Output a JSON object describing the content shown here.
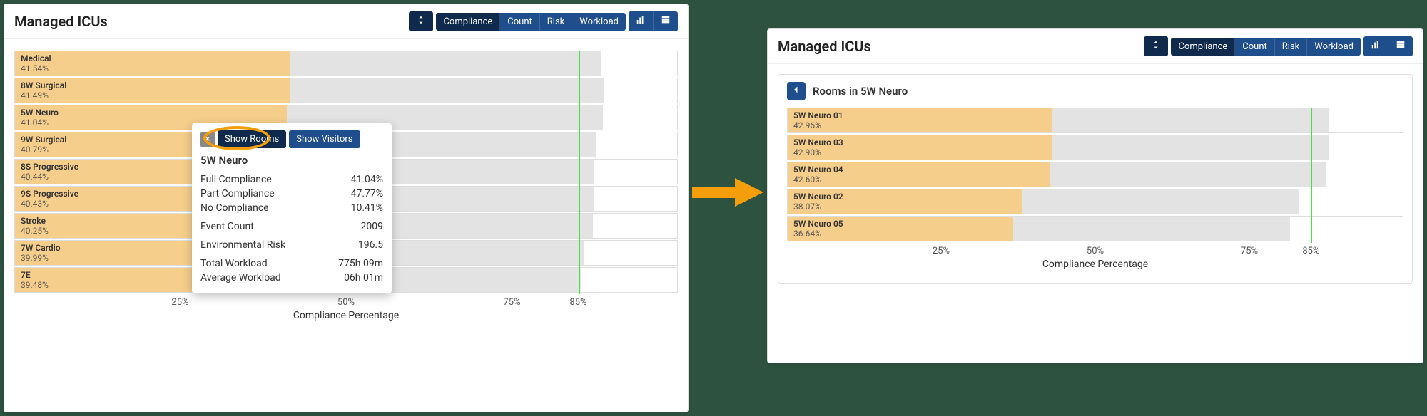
{
  "left": {
    "title": "Managed ICUs",
    "toolbar": {
      "compliance": "Compliance",
      "count": "Count",
      "risk": "Risk",
      "workload": "Workload"
    },
    "axis_label": "Compliance Percentage",
    "ticks": [
      "25%",
      "50%",
      "75%",
      "85%"
    ],
    "threshold": 85,
    "bars": [
      {
        "name": "Medical",
        "pct": "41.54%",
        "full": 41.54,
        "part": 47.0
      },
      {
        "name": "8W Surgical",
        "pct": "41.49%",
        "full": 41.49,
        "part": 47.5
      },
      {
        "name": "5W Neuro",
        "pct": "41.04%",
        "full": 41.04,
        "part": 47.77
      },
      {
        "name": "9W Surgical",
        "pct": "40.79%",
        "full": 40.79,
        "part": 47.0
      },
      {
        "name": "8S Progressive",
        "pct": "40.44%",
        "full": 40.44,
        "part": 47.0
      },
      {
        "name": "9S Progressive",
        "pct": "40.43%",
        "full": 40.43,
        "part": 47.0
      },
      {
        "name": "Stroke",
        "pct": "40.25%",
        "full": 40.25,
        "part": 47.0
      },
      {
        "name": "7W Cardio",
        "pct": "39.99%",
        "full": 39.99,
        "part": 46.0
      },
      {
        "name": "7E",
        "pct": "39.48%",
        "full": 39.48,
        "part": 46.0
      }
    ],
    "popover": {
      "close": "×",
      "show_rooms": "Show Rooms",
      "show_visitors": "Show Visitors",
      "title": "5W Neuro",
      "stats": {
        "full_compliance_label": "Full Compliance",
        "full_compliance_val": "41.04%",
        "part_compliance_label": "Part Compliance",
        "part_compliance_val": "47.77%",
        "no_compliance_label": "No Compliance",
        "no_compliance_val": "10.41%",
        "event_count_label": "Event Count",
        "event_count_val": "2009",
        "env_risk_label": "Environmental Risk",
        "env_risk_val": "196.5",
        "total_workload_label": "Total Workload",
        "total_workload_val": "775h 09m",
        "avg_workload_label": "Average Workload",
        "avg_workload_val": "06h 01m"
      }
    }
  },
  "right": {
    "title": "Managed ICUs",
    "toolbar": {
      "compliance": "Compliance",
      "count": "Count",
      "risk": "Risk",
      "workload": "Workload"
    },
    "back_title": "Rooms in 5W Neuro",
    "axis_label": "Compliance Percentage",
    "ticks": [
      "25%",
      "50%",
      "75%",
      "85%"
    ],
    "threshold": 85,
    "bars": [
      {
        "name": "5W Neuro 01",
        "pct": "42.96%",
        "full": 42.96,
        "part": 45.0
      },
      {
        "name": "5W Neuro 03",
        "pct": "42.90%",
        "full": 42.9,
        "part": 45.0
      },
      {
        "name": "5W Neuro 04",
        "pct": "42.60%",
        "full": 42.6,
        "part": 45.0
      },
      {
        "name": "5W Neuro 02",
        "pct": "38.07%",
        "full": 38.07,
        "part": 45.0
      },
      {
        "name": "5W Neuro 05",
        "pct": "36.64%",
        "full": 36.64,
        "part": 45.0
      }
    ]
  },
  "chart_data": [
    {
      "type": "bar",
      "title": "Managed ICUs — Compliance Percentage",
      "xlabel": "Compliance Percentage",
      "ylabel": "",
      "categories": [
        "Medical",
        "8W Surgical",
        "5W Neuro",
        "9W Surgical",
        "8S Progressive",
        "9S Progressive",
        "Stroke",
        "7W Cardio",
        "7E"
      ],
      "series": [
        {
          "name": "Full Compliance",
          "values": [
            41.54,
            41.49,
            41.04,
            40.79,
            40.44,
            40.43,
            40.25,
            39.99,
            39.48
          ]
        },
        {
          "name": "Part Compliance",
          "values": [
            47.0,
            47.5,
            47.77,
            47.0,
            47.0,
            47.0,
            47.0,
            46.0,
            46.0
          ]
        }
      ],
      "xlim": [
        0,
        100
      ],
      "threshold": 85
    },
    {
      "type": "bar",
      "title": "Rooms in 5W Neuro — Compliance Percentage",
      "xlabel": "Compliance Percentage",
      "ylabel": "",
      "categories": [
        "5W Neuro 01",
        "5W Neuro 03",
        "5W Neuro 04",
        "5W Neuro 02",
        "5W Neuro 05"
      ],
      "series": [
        {
          "name": "Full Compliance",
          "values": [
            42.96,
            42.9,
            42.6,
            38.07,
            36.64
          ]
        },
        {
          "name": "Part Compliance",
          "values": [
            45.0,
            45.0,
            45.0,
            45.0,
            45.0
          ]
        }
      ],
      "xlim": [
        0,
        100
      ],
      "threshold": 85
    }
  ]
}
